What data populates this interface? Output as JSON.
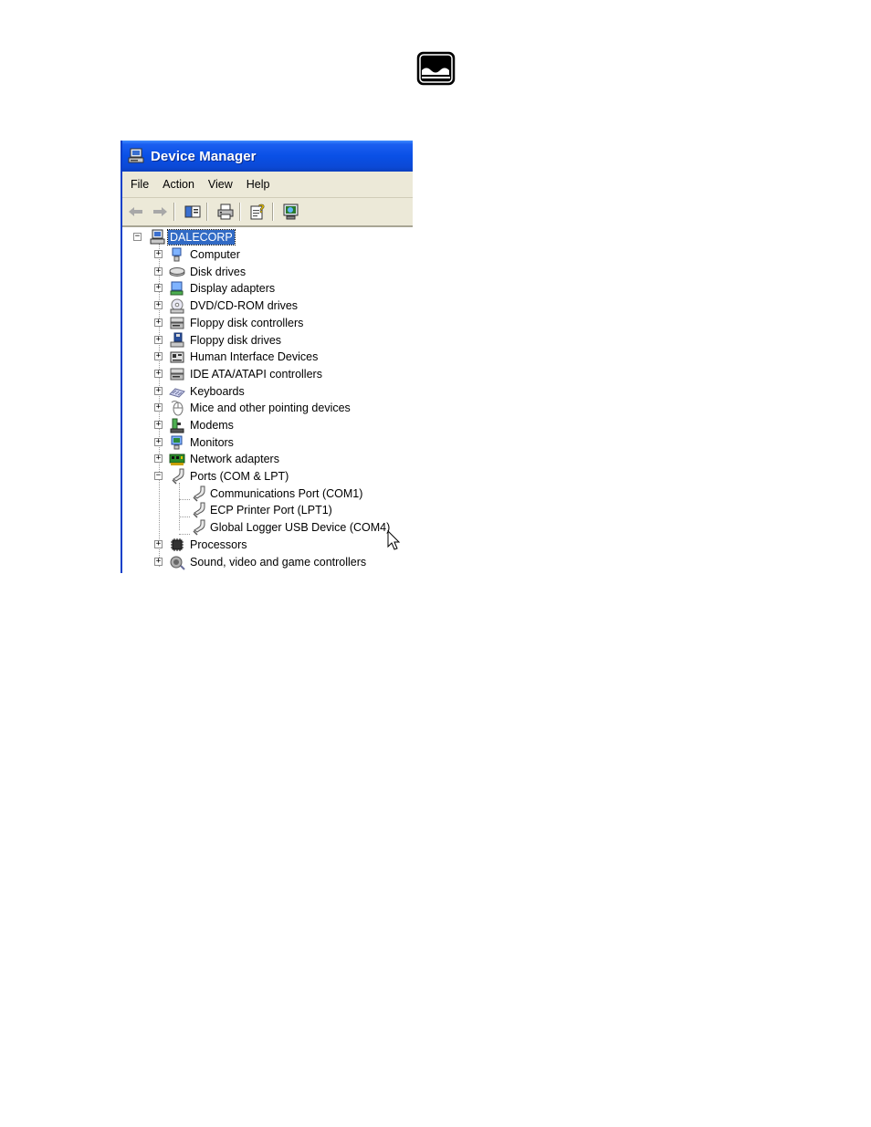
{
  "window": {
    "title": "Device Manager"
  },
  "menu": [
    "File",
    "Action",
    "View",
    "Help"
  ],
  "toolbar": {
    "buttons": [
      "back-icon",
      "forward-icon",
      "show-hide-console-tree-icon",
      "print-icon",
      "help-icon",
      "scan-hardware-icon"
    ]
  },
  "tree": {
    "root": "DALECORP",
    "categories": [
      {
        "label": "Computer",
        "icon": "computer-icon",
        "expanded": false
      },
      {
        "label": "Disk drives",
        "icon": "disk-drive-icon",
        "expanded": false
      },
      {
        "label": "Display adapters",
        "icon": "display-adapter-icon",
        "expanded": false
      },
      {
        "label": "DVD/CD-ROM drives",
        "icon": "cdrom-icon",
        "expanded": false
      },
      {
        "label": "Floppy disk controllers",
        "icon": "controller-icon",
        "expanded": false
      },
      {
        "label": "Floppy disk drives",
        "icon": "floppy-drive-icon",
        "expanded": false
      },
      {
        "label": "Human Interface Devices",
        "icon": "hid-icon",
        "expanded": false
      },
      {
        "label": "IDE ATA/ATAPI controllers",
        "icon": "controller-icon",
        "expanded": false
      },
      {
        "label": "Keyboards",
        "icon": "keyboard-icon",
        "expanded": false
      },
      {
        "label": "Mice and other pointing devices",
        "icon": "mouse-icon",
        "expanded": false
      },
      {
        "label": "Modems",
        "icon": "modem-icon",
        "expanded": false
      },
      {
        "label": "Monitors",
        "icon": "monitor-icon",
        "expanded": false
      },
      {
        "label": "Network adapters",
        "icon": "network-adapter-icon",
        "expanded": false
      },
      {
        "label": "Ports (COM & LPT)",
        "icon": "port-icon",
        "expanded": true,
        "children": [
          "Communications Port (COM1)",
          "ECP Printer Port (LPT1)",
          "Global Logger USB Device (COM4)"
        ]
      },
      {
        "label": "Processors",
        "icon": "processor-icon",
        "expanded": false
      },
      {
        "label": "Sound, video and game controllers",
        "icon": "sound-icon",
        "expanded": false
      }
    ]
  },
  "colors": {
    "titlebar": "#0a50e6",
    "chrome": "#ece9d8",
    "selection": "#316ac5"
  }
}
